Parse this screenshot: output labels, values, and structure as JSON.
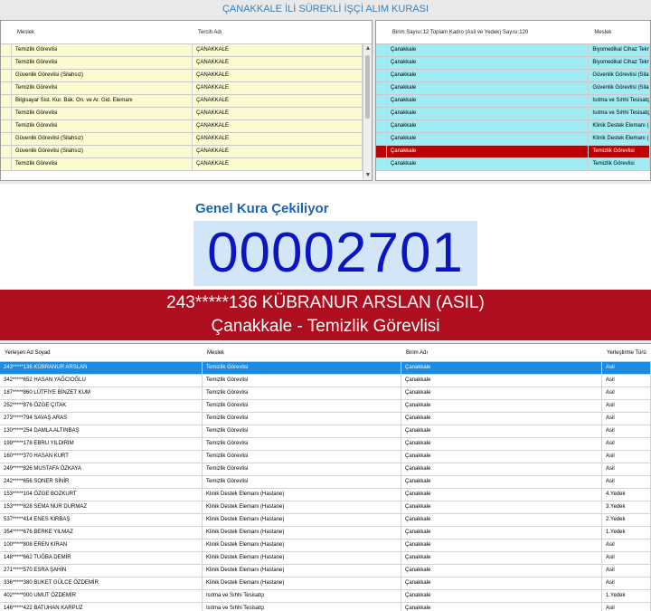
{
  "window": {
    "title": "ÇANAKKALE İLİ SÜREKLİ İŞÇİ ALIM KURASI"
  },
  "left_grid": {
    "columns": [
      "Meslek",
      "Tercih Adı"
    ],
    "rows": [
      [
        "Temizlik Görevlisi",
        "ÇANAKKALE"
      ],
      [
        "Temizlik Görevlisi",
        "ÇANAKKALE"
      ],
      [
        "Güvenlik Görevlisi (Silahsız)",
        "ÇANAKKALE"
      ],
      [
        "Temizlik Görevlisi",
        "ÇANAKKALE"
      ],
      [
        "Bilgisayar Sist. Kur. Bak. On. ve Ar. Gid. Elemanı",
        "ÇANAKKALE"
      ],
      [
        "Temizlik Görevlisi",
        "ÇANAKKALE"
      ],
      [
        "Temizlik Görevlisi",
        "ÇANAKKALE"
      ],
      [
        "Güvenlik Görevlisi (Silahsız)",
        "ÇANAKKALE"
      ],
      [
        "Güvenlik Görevlisi (Silahsız)",
        "ÇANAKKALE"
      ],
      [
        "Temizlik Görevlisi",
        "ÇANAKKALE"
      ]
    ]
  },
  "right_grid": {
    "columns": [
      "Birim Sayısı:12 Toplam Kadro (Asil ve Yedek) Sayısı:120",
      "Meslek"
    ],
    "rows": [
      [
        "Çanakkale",
        "Biyomedikal Cihaz Tekn."
      ],
      [
        "Çanakkale",
        "Biyomedikal Cihaz Tekn."
      ],
      [
        "Çanakkale",
        "Güvenlik Görevlisi (Silahsız)"
      ],
      [
        "Çanakkale",
        "Güvenlik Görevlisi (Silahsız)"
      ],
      [
        "Çanakkale",
        "Isıtma ve Sıhhi Tesisatçı"
      ],
      [
        "Çanakkale",
        "Isıtma ve Sıhhi Tesisatçı"
      ],
      [
        "Çanakkale",
        "Klinik Destek Elemanı (Hastane)"
      ],
      [
        "Çanakkale",
        "Klinik Destek Elemanı (Hastane)"
      ],
      [
        "Çanakkale",
        "Temizlik Görevlisi"
      ],
      [
        "Çanakkale",
        "Temizlik Görevlisi"
      ]
    ],
    "highlight_row": 8
  },
  "draw": {
    "label": "Genel Kura Çekiliyor",
    "counter": "00002701"
  },
  "banner": {
    "line1": "243*****136 KÜBRANUR ARSLAN (ASIL)",
    "line2": "Çanakkale - Temizlik Görevlisi"
  },
  "results": {
    "columns": [
      "Yerleşen Ad Soyad",
      "Meslek",
      "Birim Adı",
      "Yerleştirme Türü"
    ],
    "rows": [
      [
        "243*****136 KÜBRANUR ARSLAN",
        "Temizlik Görevlisi",
        "Çanakkale",
        "Asil"
      ],
      [
        "342*****652 HASAN YAĞCIOĞLU",
        "Temizlik Görevlisi",
        "Çanakkale",
        "Asil"
      ],
      [
        "187*****860 LÜTFİYE BİNZET KUM",
        "Temizlik Görevlisi",
        "Çanakkale",
        "Asil"
      ],
      [
        "252*****876 ÖZGE ÇITAK",
        "Temizlik Görevlisi",
        "Çanakkale",
        "Asil"
      ],
      [
        "273*****794 SAVAŞ ARAS",
        "Temizlik Görevlisi",
        "Çanakkale",
        "Asil"
      ],
      [
        "130*****254 DAMLA ALTINBAŞ",
        "Temizlik Görevlisi",
        "Çanakkale",
        "Asil"
      ],
      [
        "199*****178 EBRU YILDIRIM",
        "Temizlik Görevlisi",
        "Çanakkale",
        "Asil"
      ],
      [
        "160*****370 HASAN KURT",
        "Temizlik Görevlisi",
        "Çanakkale",
        "Asil"
      ],
      [
        "249*****826 MUSTAFA ÖZKAYA",
        "Temizlik Görevlisi",
        "Çanakkale",
        "Asil"
      ],
      [
        "242*****656 SONER SİNİR",
        "Temizlik Görevlisi",
        "Çanakkale",
        "Asil"
      ],
      [
        "153*****104 ÖZGE BOZKURT",
        "Klinik Destek Elemanı (Hastane)",
        "Çanakkale",
        "4.Yedek"
      ],
      [
        "153*****828 SEMA NUR DURMAZ",
        "Klinik Destek Elemanı (Hastane)",
        "Çanakkale",
        "3.Yedek"
      ],
      [
        "537*****414 ENES KIRBAŞ",
        "Klinik Destek Elemanı (Hastane)",
        "Çanakkale",
        "2.Yedek"
      ],
      [
        "354*****676 BERKE YILMAZ",
        "Klinik Destek Elemanı (Hastane)",
        "Çanakkale",
        "1.Yedek"
      ],
      [
        "100*****808 EREN KIRAN",
        "Klinik Destek Elemanı (Hastane)",
        "Çanakkale",
        "Asil"
      ],
      [
        "148*****662 TUĞBA DEMİR",
        "Klinik Destek Elemanı (Hastane)",
        "Çanakkale",
        "Asil"
      ],
      [
        "271*****570 ESRA ŞAHİN",
        "Klinik Destek Elemanı (Hastane)",
        "Çanakkale",
        "Asil"
      ],
      [
        "336*****380 BUKET GÜLCE ÖZDEMİR",
        "Klinik Destek Elemanı (Hastane)",
        "Çanakkale",
        "Asil"
      ],
      [
        "402*****000 UMUT ÖZDEMİR",
        "Isıtma ve Sıhhi Tesisatçı",
        "Çanakkale",
        "1.Yedek"
      ],
      [
        "146*****422 BATUHAN KARPUZ",
        "Isıtma ve Sıhhi Tesisatçı",
        "Çanakkale",
        "Asil"
      ]
    ],
    "selected_row": 0
  },
  "colors": {
    "banner": "#ad0f1e",
    "counter": "#0b16c2",
    "selected": "#1e8ae0",
    "highlight": "#c00000"
  },
  "icons": {
    "scroll_up": "chevron-up-icon",
    "scroll_down": "chevron-down-icon"
  }
}
